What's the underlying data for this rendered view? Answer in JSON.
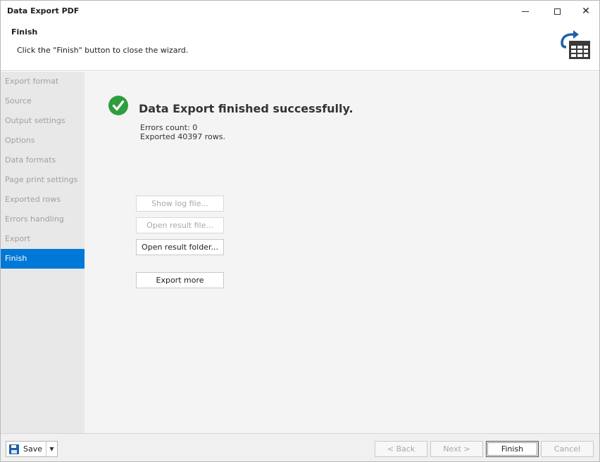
{
  "window": {
    "title": "Data Export PDF"
  },
  "header": {
    "step_title": "Finish",
    "step_description": "Click the \"Finish\" button to close the wizard.",
    "icon": "export-table-icon"
  },
  "sidebar": {
    "items": [
      {
        "label": "Export format",
        "active": false
      },
      {
        "label": "Source",
        "active": false
      },
      {
        "label": "Output settings",
        "active": false
      },
      {
        "label": "Options",
        "active": false
      },
      {
        "label": "Data formats",
        "active": false
      },
      {
        "label": "Page print settings",
        "active": false
      },
      {
        "label": "Exported rows",
        "active": false
      },
      {
        "label": "Errors handling",
        "active": false
      },
      {
        "label": "Export",
        "active": false
      },
      {
        "label": "Finish",
        "active": true
      }
    ]
  },
  "main": {
    "status_icon": "check-circle-icon",
    "status_title": "Data Export finished successfully.",
    "errors_count": "Errors count: 0",
    "exported_rows": "Exported 40397 rows.",
    "buttons": {
      "show_log": "Show log file...",
      "open_result_file": "Open result file...",
      "open_result_folder": "Open result folder...",
      "export_more": "Export more"
    }
  },
  "footer": {
    "save_label": "Save",
    "back_label": "< Back",
    "next_label": "Next >",
    "finish_label": "Finish",
    "cancel_label": "Cancel"
  },
  "colors": {
    "accent": "#0078d7",
    "success": "#2e9e3e",
    "sidebar_bg": "#e8e8e8",
    "content_bg": "#f4f4f4"
  }
}
